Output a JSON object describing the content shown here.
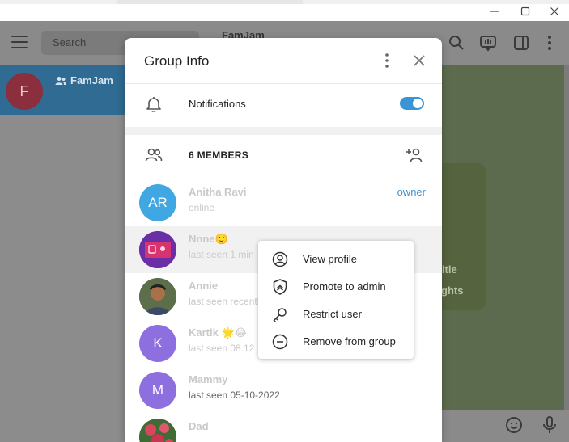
{
  "left": {
    "search_placeholder": "Search",
    "chat": {
      "avatar_letter": "F",
      "name": "FamJam"
    }
  },
  "chat": {
    "title": "FamJam",
    "bubble_line1": "/title",
    "bubble_line2": "ghts"
  },
  "dialog": {
    "title": "Group Info",
    "notifications_label": "Notifications",
    "notifications_on": true,
    "members_label": "6 MEMBERS",
    "members": [
      {
        "initials": "AR",
        "name": "Anitha Ravi",
        "status": "online",
        "role": "owner",
        "color": "#40a7e3"
      },
      {
        "initials": "",
        "name": "Nnne🙂",
        "status": "last seen 1 min",
        "role": "",
        "color": "#7a3fb4"
      },
      {
        "initials": "",
        "name": "Annie",
        "status": "last seen recently",
        "role": "",
        "color": "#6b7a5a"
      },
      {
        "initials": "K",
        "name": "Kartik 🌟😂",
        "status": "last seen 08.12",
        "role": "",
        "color": "#8e6fe0"
      },
      {
        "initials": "M",
        "name": "Mammy",
        "status": "last seen 05-10-2022",
        "role": "",
        "color": "#8e6fe0"
      },
      {
        "initials": "",
        "name": "Dad",
        "status": "",
        "role": "",
        "color": "#c2455a"
      }
    ]
  },
  "context_menu": {
    "items": [
      {
        "label": "View profile",
        "icon": "user-circle-icon"
      },
      {
        "label": "Promote to admin",
        "icon": "shield-icon"
      },
      {
        "label": "Restrict user",
        "icon": "key-icon"
      },
      {
        "label": "Remove from group",
        "icon": "minus-circle-icon"
      }
    ]
  },
  "colors": {
    "accent": "#3a95d6",
    "selected_chat": "#2f6b92"
  }
}
